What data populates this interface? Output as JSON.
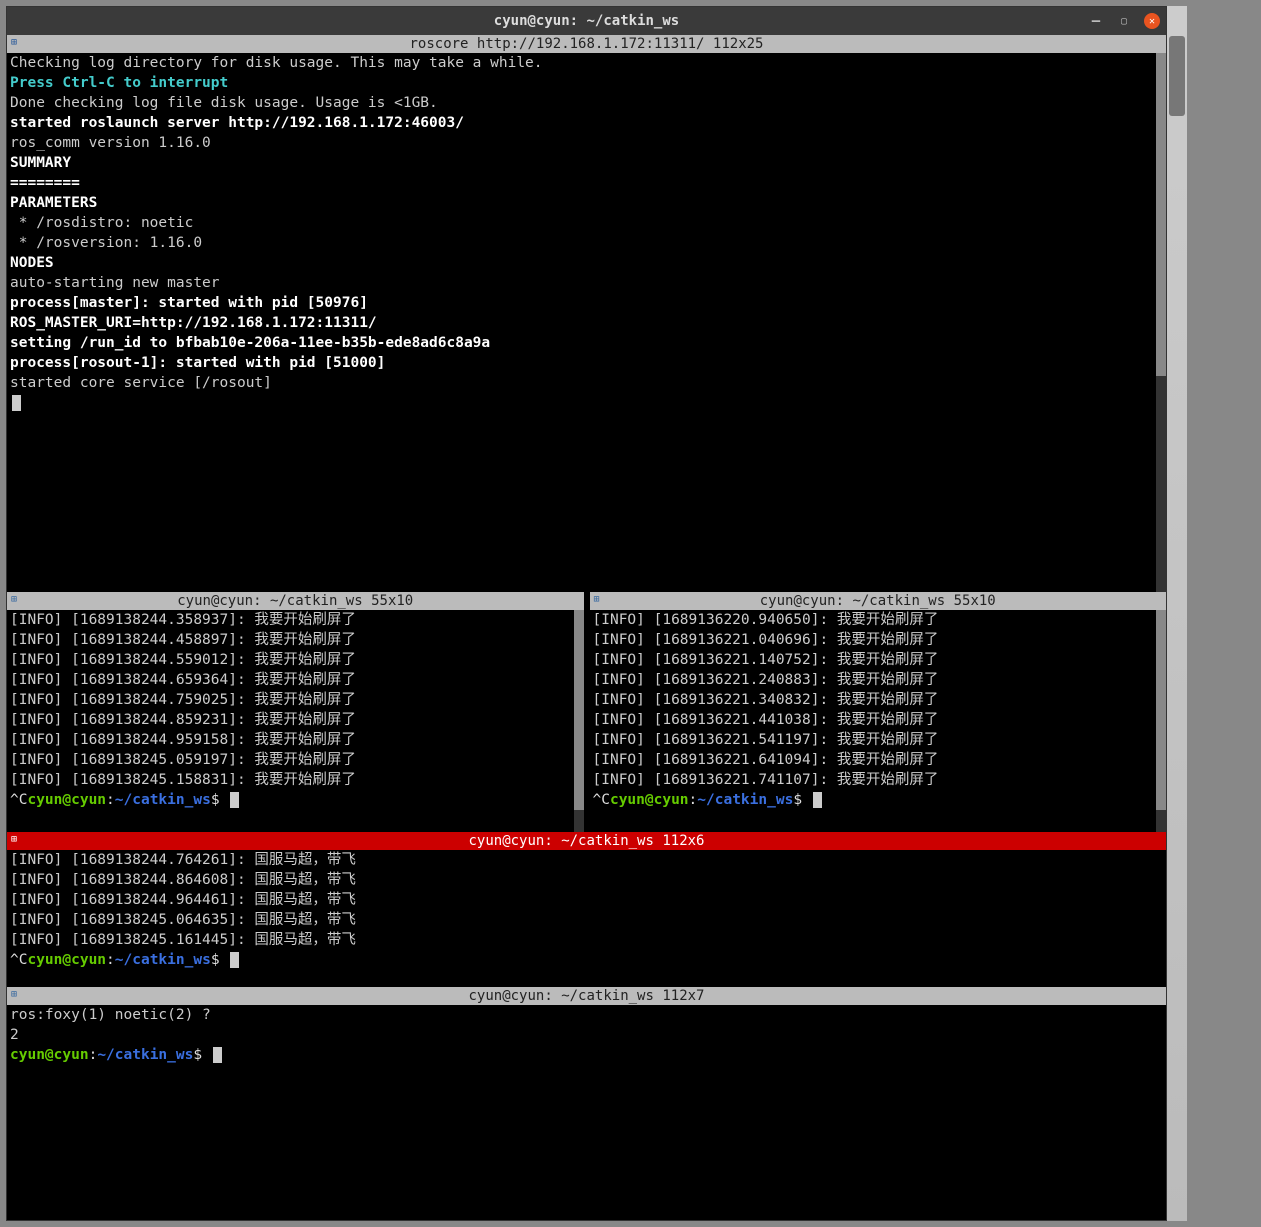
{
  "window": {
    "title": "cyun@cyun: ~/catkin_ws"
  },
  "panes": {
    "top": {
      "title": "roscore http://192.168.1.172:11311/ 112x25",
      "lines": [
        {
          "t": "Checking log directory for disk usage. This may take a while.",
          "cls": ""
        },
        {
          "t": "Press Ctrl-C to interrupt",
          "cls": "c-cyanb"
        },
        {
          "t": "Done checking log file disk usage. Usage is <1GB.",
          "cls": ""
        },
        {
          "t": "",
          "cls": ""
        },
        {
          "t": "started roslaunch server http://192.168.1.172:46003/",
          "cls": "c-bold"
        },
        {
          "t": "ros_comm version 1.16.0",
          "cls": ""
        },
        {
          "t": "",
          "cls": ""
        },
        {
          "t": "",
          "cls": ""
        },
        {
          "t": "SUMMARY",
          "cls": "c-bold"
        },
        {
          "t": "========",
          "cls": "c-bold"
        },
        {
          "t": "",
          "cls": ""
        },
        {
          "t": "PARAMETERS",
          "cls": "c-bold"
        },
        {
          "t": " * /rosdistro: noetic",
          "cls": ""
        },
        {
          "t": " * /rosversion: 1.16.0",
          "cls": ""
        },
        {
          "t": "",
          "cls": ""
        },
        {
          "t": "NODES",
          "cls": "c-bold"
        },
        {
          "t": "",
          "cls": ""
        },
        {
          "t": "auto-starting new master",
          "cls": ""
        },
        {
          "t": "process[master]: started with pid [50976]",
          "cls": "c-bold"
        },
        {
          "t": "ROS_MASTER_URI=http://192.168.1.172:11311/",
          "cls": "c-bold"
        },
        {
          "t": "",
          "cls": ""
        },
        {
          "t": "setting /run_id to bfbab10e-206a-11ee-b35b-ede8ad6c8a9a",
          "cls": "c-bold"
        },
        {
          "t": "process[rosout-1]: started with pid [51000]",
          "cls": "c-bold"
        },
        {
          "t": "started core service [/rosout]",
          "cls": ""
        }
      ]
    },
    "mid_left": {
      "title": "cyun@cyun: ~/catkin_ws 55x10",
      "info_lines": [
        "[INFO] [1689138244.358937]: 我要开始刷屏了",
        "[INFO] [1689138244.458897]: 我要开始刷屏了",
        "[INFO] [1689138244.559012]: 我要开始刷屏了",
        "[INFO] [1689138244.659364]: 我要开始刷屏了",
        "[INFO] [1689138244.759025]: 我要开始刷屏了",
        "[INFO] [1689138244.859231]: 我要开始刷屏了",
        "[INFO] [1689138244.959158]: 我要开始刷屏了",
        "[INFO] [1689138245.059197]: 我要开始刷屏了",
        "[INFO] [1689138245.158831]: 我要开始刷屏了"
      ],
      "prompt": {
        "pre": "^C",
        "user": "cyun@cyun",
        "sep": ":",
        "path": "~/catkin_ws",
        "tail": "$"
      }
    },
    "mid_right": {
      "title": "cyun@cyun: ~/catkin_ws 55x10",
      "info_lines": [
        "[INFO] [1689136220.940650]: 我要开始刷屏了",
        "[INFO] [1689136221.040696]: 我要开始刷屏了",
        "[INFO] [1689136221.140752]: 我要开始刷屏了",
        "[INFO] [1689136221.240883]: 我要开始刷屏了",
        "[INFO] [1689136221.340832]: 我要开始刷屏了",
        "[INFO] [1689136221.441038]: 我要开始刷屏了",
        "[INFO] [1689136221.541197]: 我要开始刷屏了",
        "[INFO] [1689136221.641094]: 我要开始刷屏了",
        "[INFO] [1689136221.741107]: 我要开始刷屏了"
      ],
      "prompt": {
        "pre": "^C",
        "user": "cyun@cyun",
        "sep": ":",
        "path": "~/catkin_ws",
        "tail": "$"
      }
    },
    "bot1": {
      "title": "cyun@cyun: ~/catkin_ws 112x6",
      "info_lines": [
        "[INFO] [1689138244.764261]: 国服马超，带飞",
        "[INFO] [1689138244.864608]: 国服马超，带飞",
        "[INFO] [1689138244.964461]: 国服马超，带飞",
        "[INFO] [1689138245.064635]: 国服马超，带飞",
        "[INFO] [1689138245.161445]: 国服马超，带飞"
      ],
      "prompt": {
        "pre": "^C",
        "user": "cyun@cyun",
        "sep": ":",
        "path": "~/catkin_ws",
        "tail": "$"
      }
    },
    "bot2": {
      "title": "cyun@cyun: ~/catkin_ws 112x7",
      "lines": [
        "ros:foxy(1) noetic(2) ?",
        "2"
      ],
      "prompt": {
        "pre": "",
        "user": "cyun@cyun",
        "sep": ":",
        "path": "~/catkin_ws",
        "tail": "$"
      }
    }
  }
}
